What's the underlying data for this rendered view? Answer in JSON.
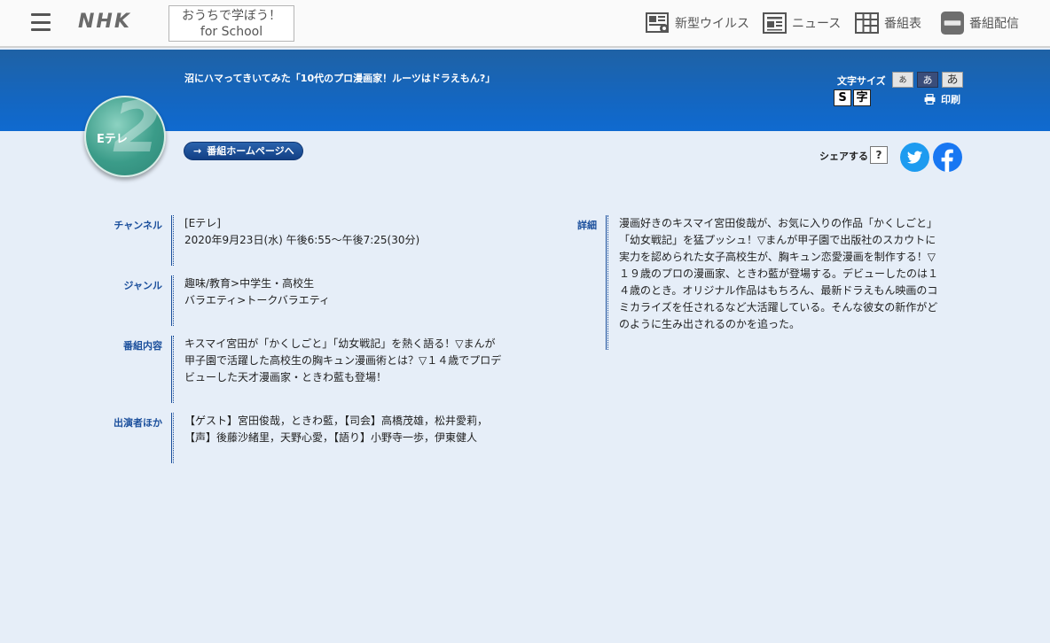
{
  "header": {
    "logo": "NHK",
    "school_line1": "おうちで学ぼう！",
    "school_line2": "for School",
    "nav": [
      {
        "label": "新型ウイルス",
        "icon": "virus-news-icon"
      },
      {
        "label": "ニュース",
        "icon": "newspaper-icon"
      },
      {
        "label": "番組表",
        "icon": "program-grid-icon"
      },
      {
        "label": "番組配信",
        "icon": "nhk-plus-icon"
      }
    ]
  },
  "program": {
    "title": "沼にハマってきいてみた「10代のプロ漫画家！ルーツはドラえもん?」",
    "channel_badge": "Eテレ",
    "channel_number": "2",
    "homepage_button": "番組ホームページへ"
  },
  "tools": {
    "font_size_label": "文字サイズ",
    "sizes": [
      "あ",
      "あ",
      "あ"
    ],
    "ruby": [
      "S",
      "字"
    ],
    "print_label": "印刷",
    "share_label": "シェアする",
    "share_help": "?"
  },
  "info": {
    "channel": {
      "label": "チャンネル",
      "lines": [
        "[Eテレ]",
        "2020年9月23日(水) 午後6:55〜午後7:25(30分)"
      ]
    },
    "genre": {
      "label": "ジャンル",
      "lines": [
        "趣味/教育>中学生・高校生",
        "バラエティ>トークバラエティ"
      ]
    },
    "content": {
      "label": "番組内容",
      "lines": [
        "キスマイ宮田が「かくしごと」「幼女戦記」を熱く語る！▽まんが",
        "甲子園で活躍した高校生の胸キュン漫画術とは？▽１４歳でプロデ",
        "ビューした天才漫画家・ときわ藍も登場！"
      ]
    },
    "cast": {
      "label": "出演者ほか",
      "lines": [
        "【ゲスト】宮田俊哉，ときわ藍，【司会】高橋茂雄，松井愛莉，",
        "【声】後藤沙緒里，天野心愛，【語り】小野寺一歩，伊東健人"
      ]
    },
    "detail": {
      "label": "詳細",
      "lines": [
        "漫画好きのキスマイ宮田俊哉が、お気に入りの作品「かくしごと」",
        "「幼女戦記」を猛プッシュ！▽まんが甲子園で出版社のスカウトに",
        "実力を認められた女子高校生が、胸キュン恋愛漫画を制作する！▽",
        "１９歳のプロの漫画家、ときわ藍が登場する。デビューしたのは１",
        "４歳のとき。オリジナル作品はもちろん、最新ドラえもん映画のコ",
        "ミカライズを任されるなど大活躍している。そんな彼女の新作がど",
        "のように生み出されるのかを追った。"
      ]
    }
  },
  "colors": {
    "band": "#1466c0",
    "label_blue": "#1b4f9c",
    "page_bg": "#e6eef8",
    "etele_green": "#3b9c89"
  }
}
